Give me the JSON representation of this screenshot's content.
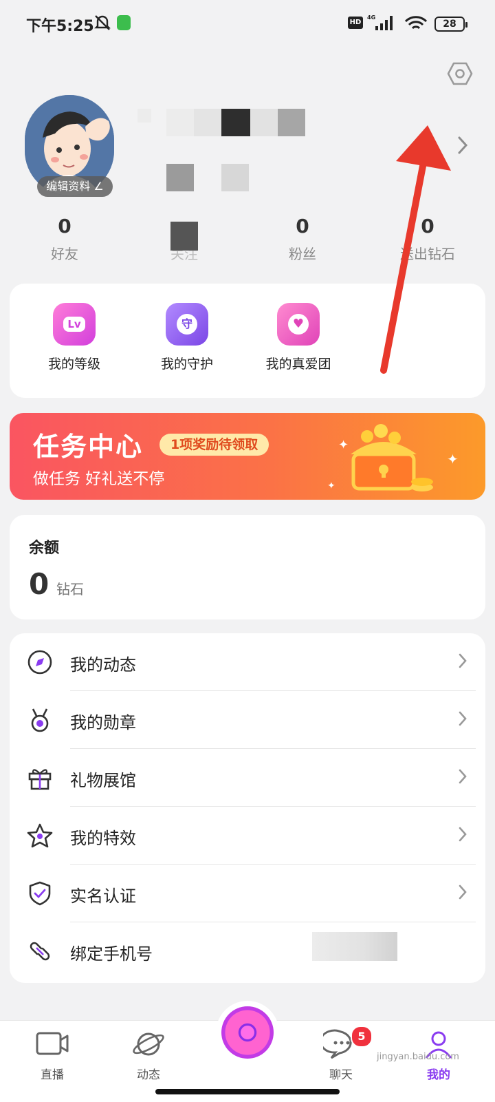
{
  "status_bar": {
    "time": "下午5:25",
    "network": "4G",
    "hd": "HD",
    "battery": "28"
  },
  "profile": {
    "edit_label": "编辑资料"
  },
  "stats": [
    {
      "value": "0",
      "label": "好友"
    },
    {
      "value": "",
      "label": "关注"
    },
    {
      "value": "0",
      "label": "粉丝"
    },
    {
      "value": "0",
      "label": "送出钻石"
    }
  ],
  "shortcuts": [
    {
      "label": "我的等级",
      "icon": "level-icon",
      "badge": "Lv"
    },
    {
      "label": "我的守护",
      "icon": "guard-icon",
      "badge": "守"
    },
    {
      "label": "我的真爱团",
      "icon": "heart-team-icon",
      "badge": "♥"
    }
  ],
  "task_banner": {
    "title": "任务中心",
    "pill": "1项奖励待领取",
    "subtitle": "做任务 好礼送不停"
  },
  "balance": {
    "title": "余额",
    "value": "0",
    "unit": "钻石"
  },
  "menu": [
    {
      "label": "我的动态",
      "icon": "compass-icon"
    },
    {
      "label": "我的勋章",
      "icon": "medal-icon"
    },
    {
      "label": "礼物展馆",
      "icon": "gift-icon"
    },
    {
      "label": "我的特效",
      "icon": "star-icon"
    },
    {
      "label": "实名认证",
      "icon": "shield-check-icon"
    },
    {
      "label": "绑定手机号",
      "icon": "link-icon"
    }
  ],
  "bottom_nav": [
    {
      "label": "直播",
      "icon": "live-camera-icon"
    },
    {
      "label": "动态",
      "icon": "planet-icon"
    },
    {
      "label": "",
      "icon": "record-button-icon"
    },
    {
      "label": "聊天",
      "icon": "chat-bubble-icon"
    },
    {
      "label": "我的",
      "icon": "profile-icon"
    }
  ],
  "chat_badge": "5",
  "watermark": "jingyan.baidu.com",
  "colors": {
    "accent": "#8a3cf0",
    "banner_start": "#fa5561",
    "banner_end": "#fc9a2a",
    "arrow": "#e8392c"
  }
}
